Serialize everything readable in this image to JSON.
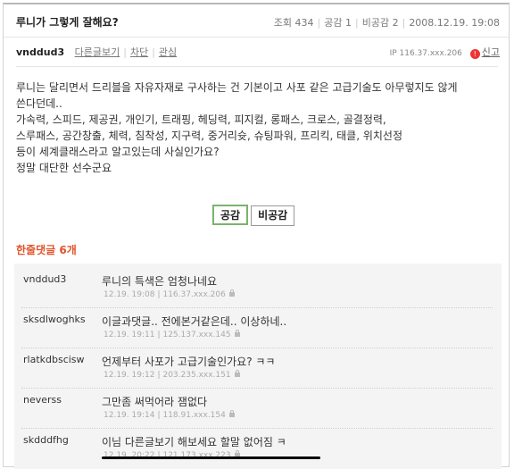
{
  "post": {
    "title": "루니가 그렇게 잘해요?",
    "views_label": "조회",
    "views": "434",
    "agree_label": "공감",
    "agree": "1",
    "disagree_label": "비공감",
    "disagree": "2",
    "date": "2008.12.19. 19:08",
    "author": "vnddud3",
    "author_links": [
      "다른글보기",
      "차단",
      "관심"
    ],
    "ip": "IP 116.37.xxx.206",
    "report_label": "신고",
    "body": [
      "루니는 달리면서 드리블을 자유자재로 구사하는 건 기본이고 사포 같은 고급기술도 아무렇지도 않게",
      "쓴다던데..",
      "가속력, 스피드, 제공권, 개인기, 트래핑, 헤딩력, 피지컬, 롱패스, 크로스, 골결정력,",
      "스루패스, 공간창출, 체력, 침착성, 지구력, 중거리슛, 슈팅파워, 프리킥, 태클, 위치선정",
      "등이 세계클래스라고 알고있는데 사실인가요?",
      "정말 대단한 선수군요"
    ],
    "vote_up": "공감",
    "vote_down": "비공감"
  },
  "comments": {
    "title": "한줄댓글",
    "count": "6개",
    "items": [
      {
        "nick": "vnddud3",
        "text": "루니의 특색은 엄청나네요",
        "time": "12.19. 19:08",
        "ip": "116.37.xxx.206"
      },
      {
        "nick": "sksdlwoghks",
        "text": "이글과댓글.. 전에본거같은데.. 이상하네..",
        "time": "12.19. 19:11",
        "ip": "125.137.xxx.145"
      },
      {
        "nick": "rlatkdbscisw",
        "text": "언제부터 사포가 고급기술인가요? ㅋㅋ",
        "time": "12.19. 19:12",
        "ip": "203.235.xxx.151"
      },
      {
        "nick": "neverss",
        "text": "그만좀 써먹어라 잼없다",
        "time": "12.19. 19:14",
        "ip": "118.91.xxx.154"
      },
      {
        "nick": "skdddfhg",
        "text": "이님 다른글보기 해보세요 할말 없어짐 ㅋ",
        "time": "12.19. 20:22",
        "ip": "121.173.xxx.223"
      }
    ]
  },
  "colors": {
    "accent": "#e0532a",
    "agree_border": "#7bb36b",
    "comment_bg": "#f4f4f4"
  }
}
